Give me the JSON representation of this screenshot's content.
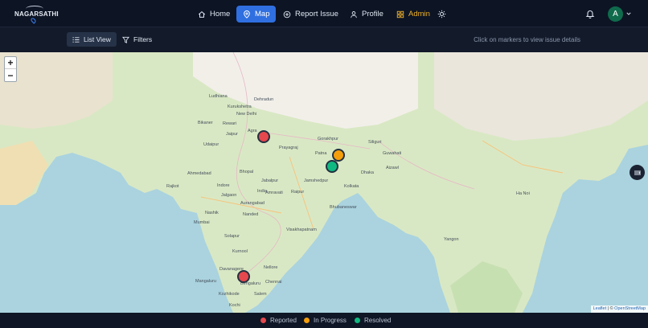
{
  "app": {
    "brand": "NAGARSATHI"
  },
  "nav": {
    "items": [
      {
        "label": "Home",
        "icon": "home-icon",
        "active": false
      },
      {
        "label": "Map",
        "icon": "map-pin-icon",
        "active": true
      },
      {
        "label": "Report Issue",
        "icon": "plus-circle-icon",
        "active": false
      },
      {
        "label": "Profile",
        "icon": "user-icon",
        "active": false
      },
      {
        "label": "Admin",
        "icon": "dashboard-icon",
        "active": false
      }
    ],
    "theme_icon": "sun-icon",
    "notification_icon": "bell-icon",
    "avatar_initial": "A"
  },
  "toolbar": {
    "list_view_label": "List View",
    "filters_label": "Filters",
    "hint": "Click on markers to view issue details"
  },
  "map": {
    "zoom_in": "+",
    "zoom_out": "−",
    "attribution_leaflet": "Leaflet",
    "attribution_osm": "OpenStreetMap",
    "attribution_sep": " | © ",
    "cities": [
      "Dehradun",
      "Ludhiana",
      "Kurukshetra",
      "New Delhi",
      "Bikaner",
      "Rewari",
      "Jaipur",
      "Agra",
      "Gorakhpur",
      "Prayagraj",
      "Patna",
      "Siliguri",
      "Udaipur",
      "Bhopal",
      "Ahmedabad",
      "Jabalpur",
      "Jamshedpur",
      "Kolkata",
      "Rajkot",
      "Indore",
      "Raipur",
      "Jalgaon",
      "Amravati",
      "Nashik",
      "Aurangabad",
      "Mumbai",
      "Bhubaneswar",
      "Nanded",
      "Solapur",
      "Visakhapatnam",
      "Kurnool",
      "Nellore",
      "Davanagere",
      "Chennai",
      "Mangaluru",
      "Bengaluru",
      "Salem",
      "Kozhikode",
      "Kochi",
      "Guwahati",
      "Aizawl",
      "India",
      "Dhaka",
      "Ha Noi",
      "Yangon"
    ]
  },
  "issues": [
    {
      "status": "reported",
      "color": "#e5484d"
    },
    {
      "status": "in_progress",
      "color": "#f59e0b"
    },
    {
      "status": "resolved",
      "color": "#10b981"
    },
    {
      "status": "reported",
      "color": "#e5484d"
    }
  ],
  "legend": [
    {
      "label": "Reported",
      "color": "#e5484d"
    },
    {
      "label": "In Progress",
      "color": "#f59e0b"
    },
    {
      "label": "Resolved",
      "color": "#10b981"
    }
  ]
}
